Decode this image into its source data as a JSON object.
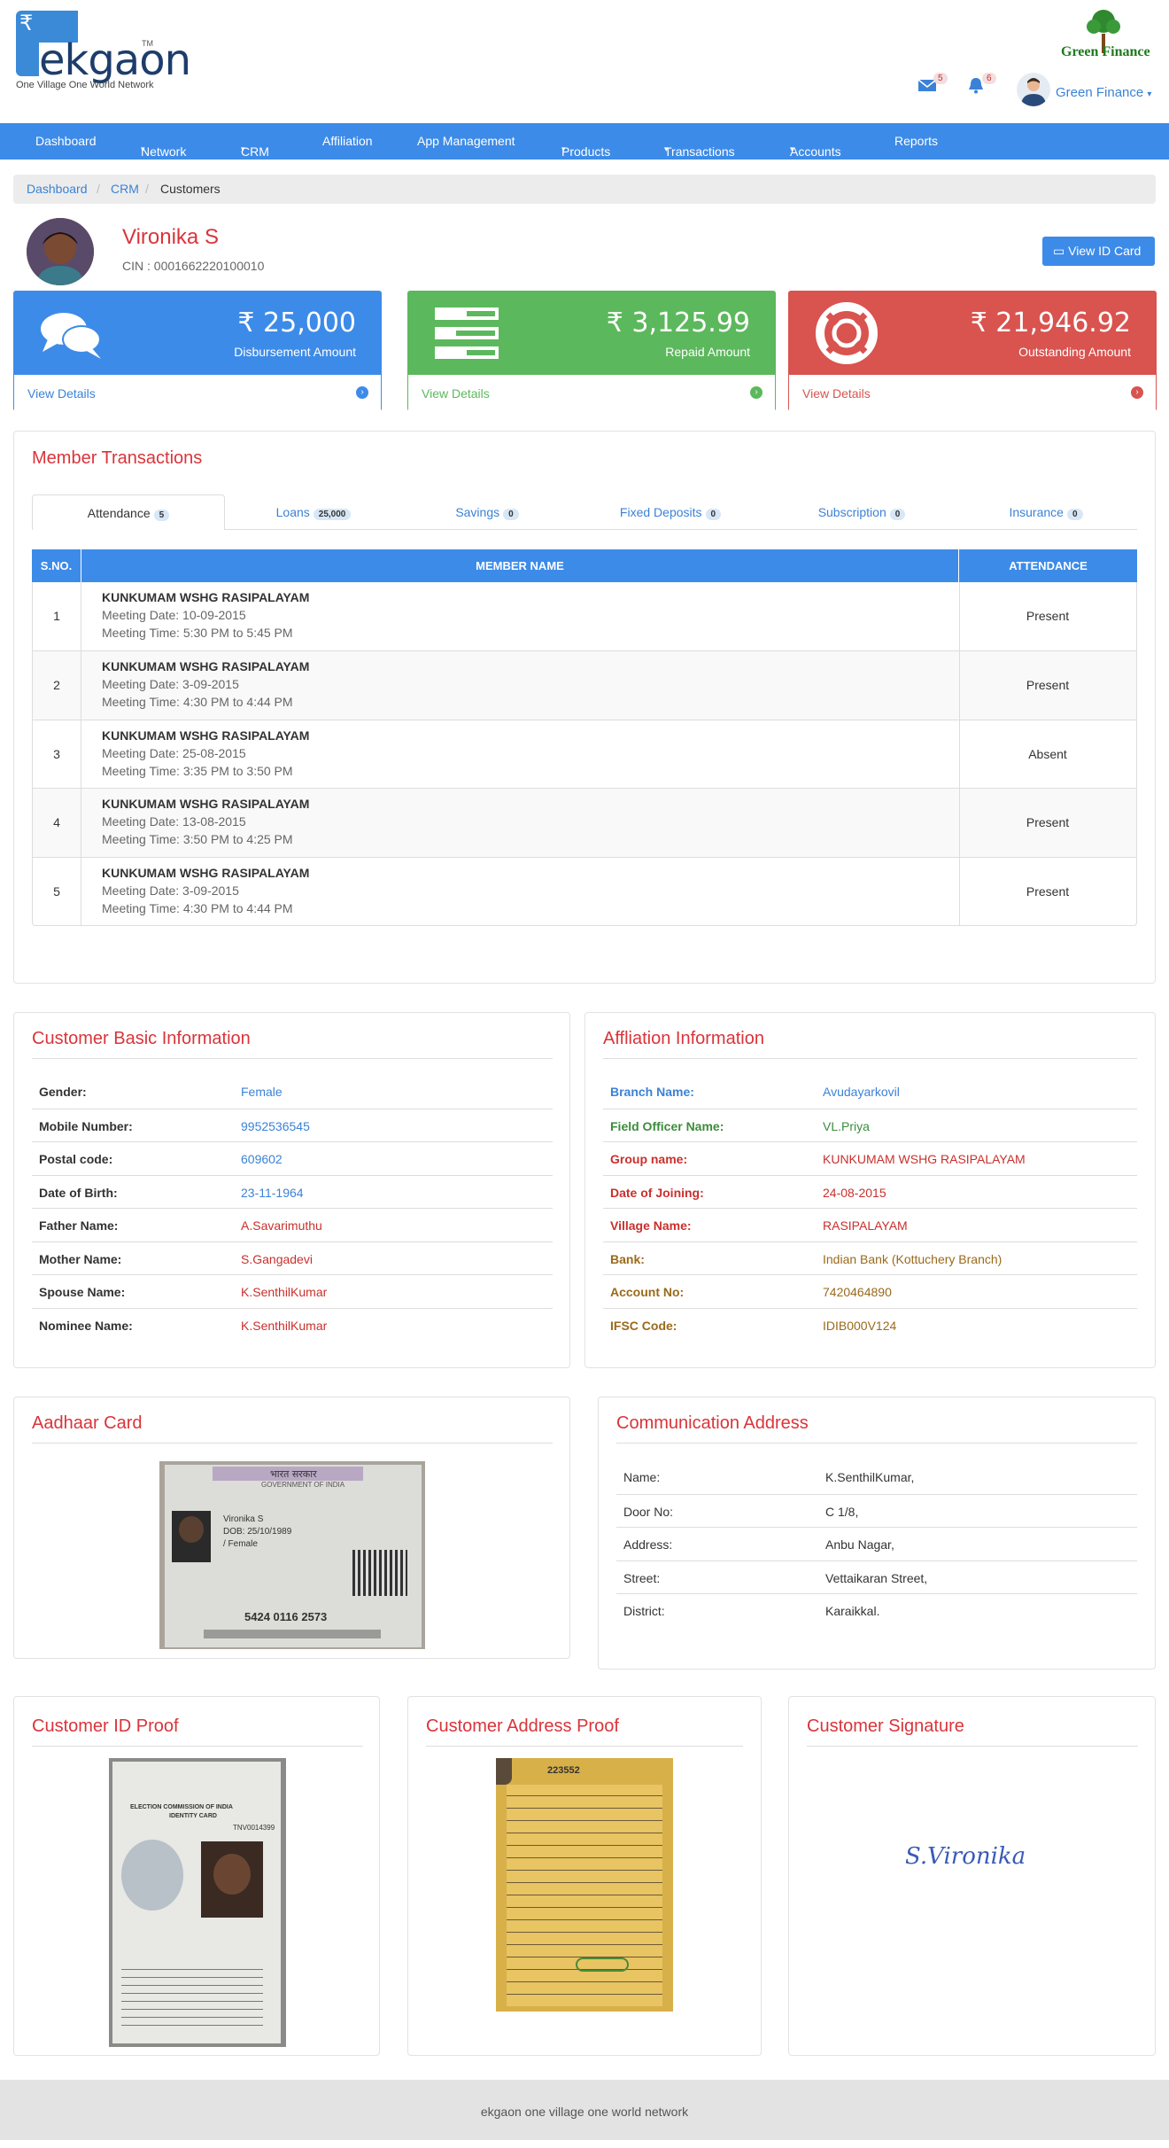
{
  "brand": {
    "rupee": "₹",
    "name": "ekgaon",
    "tm": "TM",
    "tagline": "One Village One World Network",
    "partner": "Green Finance"
  },
  "header": {
    "mail_count": "5",
    "notif_count": "6",
    "user": "Green Finance"
  },
  "nav": [
    "Dashboard",
    "Network",
    "CRM",
    "Affiliation",
    "App Management",
    "Products",
    "Transactions",
    "Accounts",
    "Reports"
  ],
  "breadcrumb": [
    "Dashboard",
    "CRM",
    "Customers"
  ],
  "profile": {
    "name": "Vironika S",
    "cin": "CIN : 0001662220100010",
    "id_button": "View ID Card"
  },
  "stats": [
    {
      "amount": "₹ 25,000",
      "label": "Disbursement Amount",
      "link": "View Details",
      "color": "#3d8be8"
    },
    {
      "amount": "₹ 3,125.99",
      "label": "Repaid Amount",
      "link": "View Details",
      "color": "#5cb85c"
    },
    {
      "amount": "₹ 21,946.92",
      "label": "Outstanding Amount",
      "link": "View Details",
      "color": "#d9534f"
    }
  ],
  "transactions": {
    "title": "Member Transactions",
    "tabs": [
      {
        "label": "Attendance",
        "count": "5"
      },
      {
        "label": "Loans",
        "count": "25,000"
      },
      {
        "label": "Savings",
        "count": "0"
      },
      {
        "label": "Fixed Deposits",
        "count": "0"
      },
      {
        "label": "Subscription",
        "count": "0"
      },
      {
        "label": "Insurance",
        "count": "0"
      }
    ],
    "columns": [
      "S.NO.",
      "MEMBER NAME",
      "ATTENDANCE"
    ],
    "rows": [
      {
        "sno": "1",
        "group": "KUNKUMAM WSHG RASIPALAYAM",
        "date": "Meeting Date: 10-09-2015",
        "time": "Meeting Time: 5:30 PM to 5:45 PM",
        "attendance": "Present"
      },
      {
        "sno": "2",
        "group": "KUNKUMAM WSHG RASIPALAYAM",
        "date": "Meeting Date: 3-09-2015",
        "time": "Meeting Time: 4:30 PM to 4:44 PM",
        "attendance": "Present"
      },
      {
        "sno": "3",
        "group": "KUNKUMAM WSHG RASIPALAYAM",
        "date": "Meeting Date: 25-08-2015",
        "time": "Meeting Time: 3:35 PM to 3:50 PM",
        "attendance": "Absent"
      },
      {
        "sno": "4",
        "group": "KUNKUMAM WSHG RASIPALAYAM",
        "date": "Meeting Date: 13-08-2015",
        "time": "Meeting Time: 3:50 PM to 4:25 PM",
        "attendance": "Present"
      },
      {
        "sno": "5",
        "group": "KUNKUMAM WSHG RASIPALAYAM",
        "date": "Meeting Date: 3-09-2015",
        "time": "Meeting Time: 4:30 PM to 4:44 PM",
        "attendance": "Present"
      }
    ]
  },
  "basic": {
    "title": "Customer Basic Information",
    "rows": [
      {
        "k": "Gender:",
        "v": "Female",
        "color": "#3b82d6"
      },
      {
        "k": "Mobile Number:",
        "v": "9952536545",
        "color": "#3b82d6"
      },
      {
        "k": "Postal code:",
        "v": "609602",
        "color": "#3b82d6"
      },
      {
        "k": "Date of Birth:",
        "v": "23-11-1964",
        "color": "#3b82d6"
      },
      {
        "k": "Father Name:",
        "v": "A.Savarimuthu",
        "color": "#c9302c"
      },
      {
        "k": "Mother Name:",
        "v": "S.Gangadevi",
        "color": "#c9302c"
      },
      {
        "k": "Spouse Name:",
        "v": "K.SenthilKumar",
        "color": "#c9302c"
      },
      {
        "k": "Nominee Name:",
        "v": "K.SenthilKumar",
        "color": "#c9302c"
      }
    ]
  },
  "affiliation": {
    "title": "Affliation Information",
    "rows": [
      {
        "k": "Branch Name:",
        "v": "Avudayarkovil",
        "color": "#3b82d6"
      },
      {
        "k": "Field Officer Name:",
        "v": "VL.Priya",
        "color": "#3c8c3c"
      },
      {
        "k": "Group name:",
        "v": "KUNKUMAM WSHG RASIPALAYAM",
        "color": "#c9302c"
      },
      {
        "k": "Date of Joining:",
        "v": "24-08-2015",
        "color": "#c9302c"
      },
      {
        "k": "Village Name:",
        "v": "RASIPALAYAM",
        "color": "#c9302c"
      },
      {
        "k": "Bank:",
        "v": "Indian Bank (Kottuchery Branch)",
        "color": "#9a6a1c"
      },
      {
        "k": "Account No:",
        "v": "7420464890",
        "color": "#9a6a1c"
      },
      {
        "k": "IFSC Code:",
        "v": "IDIB000V124",
        "color": "#9a6a1c"
      }
    ]
  },
  "aadhaar": {
    "title": "Aadhaar Card",
    "header": "भारत सरकार",
    "gov": "GOVERNMENT OF INDIA",
    "name": "Vironika S",
    "dob": "DOB: 25/10/1989",
    "gender": "/ Female",
    "number": "5424 0116 2573"
  },
  "address": {
    "title": "Communication Address",
    "rows": [
      {
        "k": "Name:",
        "v": "K.SenthilKumar,"
      },
      {
        "k": "Door No:",
        "v": "C 1/8,"
      },
      {
        "k": "Address:",
        "v": "Anbu Nagar,"
      },
      {
        "k": "Street:",
        "v": "Vettaikaran Street,"
      },
      {
        "k": "District:",
        "v": "Karaikkal."
      }
    ]
  },
  "idproof": {
    "title": "Customer ID Proof",
    "ec": "ELECTION COMMISSION OF INDIA",
    "card": "IDENTITY CARD",
    "num": "TNV0014399"
  },
  "addrproof": {
    "title": "Customer Address Proof",
    "num": "223552"
  },
  "signature": {
    "title": "Customer Signature",
    "sig": "S.Vironika"
  },
  "footer": "ekgaon one village one world network"
}
